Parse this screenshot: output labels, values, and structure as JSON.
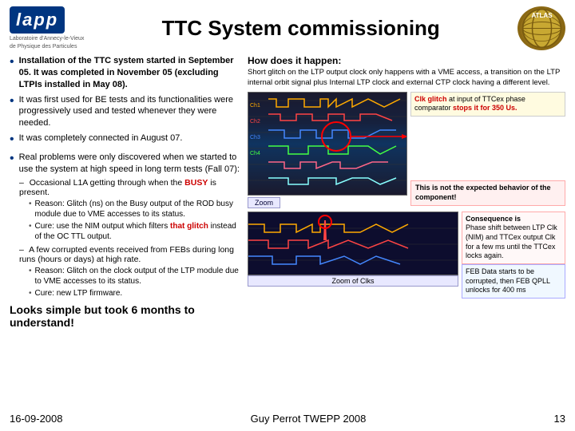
{
  "header": {
    "title": "TTC System commissioning",
    "lapp_logo": "lapp",
    "lapp_subtitle_line1": "Laboratoire d'Annecy-le-Vieux",
    "lapp_subtitle_line2": "de Physique des Particules",
    "atlas_label": "ATLAS"
  },
  "bullets": [
    {
      "text": "Installation of the TTC system started in September 05. It was completed in November 05 (excluding LTPIs installed in May 08)."
    },
    {
      "text": "It was first used for BE tests and its functionalities were progressively used and tested whenever they were needed."
    },
    {
      "text": "It was completely connected in August 07."
    },
    {
      "text": "Real problems were only discovered when we started to use the system at high speed in long term tests (Fall 07):"
    }
  ],
  "sub_items": [
    {
      "dash": "–",
      "text": "Occasional L1A getting through when the BUSY is present.",
      "sub_bullets": [
        {
          "bullet": "•",
          "text": "Reason: Glitch (ns) on the Busy output of the ROD busy module due to VME accesses to its status."
        },
        {
          "bullet": "•",
          "text": "Cure: use the NIM output which filters that glitch instead of the OC TTL output."
        }
      ]
    },
    {
      "dash": "–",
      "text": "A few corrupted events received from FEBs during long runs (hours or days) at high rate.",
      "sub_bullets": [
        {
          "bullet": "•",
          "text": "Reason: Glitch on the clock output of the LTP module due to VME accesses to its status."
        },
        {
          "bullet": "•",
          "text": "Cure: new LTP firmware."
        }
      ]
    }
  ],
  "looks_like": "Looks simple but took 6 months to understand!",
  "footer": {
    "date": "16-09-2008",
    "presenter": "Guy Perrot TWEPP 2008",
    "page_number": "13"
  },
  "right_column": {
    "how_title": "How does it happen:",
    "how_text": "Short glitch on the LTP output clock only happens with a VME access, a transition on the LTP internal orbit signal plus Internal LTP clock and external CTP clock having a different level.",
    "zoom_label": "Zoom",
    "zoom_clks_label": "Zoom of Clks",
    "annotation1_title": "Clk glitch",
    "annotation1_text": "at input of TTCex phase comparator stops it for 350 Us.",
    "annotation2_title": "This is not the expected behavior of the component!",
    "consequence_title": "Consequence is",
    "consequence_text": "Phase shift between LTP Clk (NIM) and TTCex output Clk for a fewms until the TTCex locks again.",
    "feb_text": "FEB Data starts to be corrupted, then FEB QPLL unlocks for 400 ms"
  }
}
